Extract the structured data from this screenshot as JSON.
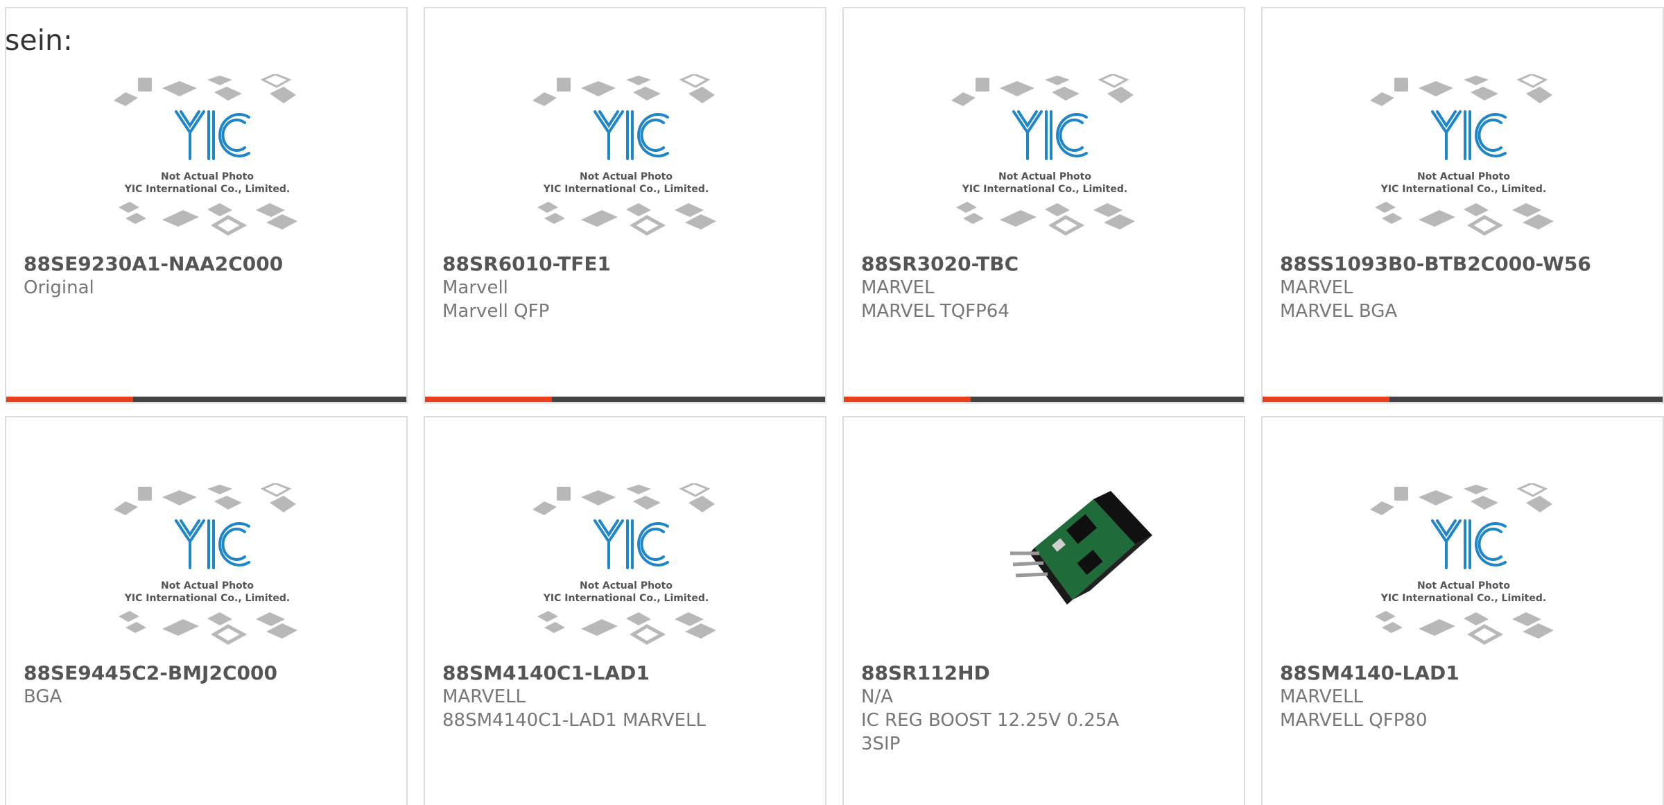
{
  "fragment_text": "sein:",
  "colors": {
    "accent_bar": "#e8401c",
    "bar_base": "#444444",
    "logo_blue": "#1f87c8",
    "chip_gray": "#b8b8b8"
  },
  "placeholder": {
    "line1": "Not Actual Photo",
    "line2": "YIC International Co., Limited.",
    "logo": "YIC"
  },
  "products": [
    {
      "name": "88SE9230A1-NAA2C000",
      "line1": "Original",
      "line2": "",
      "line3": "",
      "image": "placeholder"
    },
    {
      "name": "88SR6010-TFE1",
      "line1": "Marvell",
      "line2": "Marvell QFP",
      "line3": "",
      "image": "placeholder"
    },
    {
      "name": "88SR3020-TBC",
      "line1": "MARVEL",
      "line2": "MARVEL TQFP64",
      "line3": "",
      "image": "placeholder"
    },
    {
      "name": "88SS1093B0-BTB2C000-W56",
      "line1": "MARVEL",
      "line2": "MARVEL BGA",
      "line3": "",
      "image": "placeholder"
    },
    {
      "name": "88SE9445C2-BMJ2C000",
      "line1": "BGA",
      "line2": "",
      "line3": "",
      "image": "placeholder"
    },
    {
      "name": "88SM4140C1-LAD1",
      "line1": "MARVELL",
      "line2": "88SM4140C1-LAD1 MARVELL",
      "line3": "",
      "image": "placeholder"
    },
    {
      "name": "88SR112HD",
      "line1": "N/A",
      "line2": "IC REG BOOST 12.25V 0.25A",
      "line3": "3SIP",
      "image": "photo"
    },
    {
      "name": "88SM4140-LAD1",
      "line1": "MARVELL",
      "line2": "MARVELL QFP80",
      "line3": "",
      "image": "placeholder"
    }
  ]
}
